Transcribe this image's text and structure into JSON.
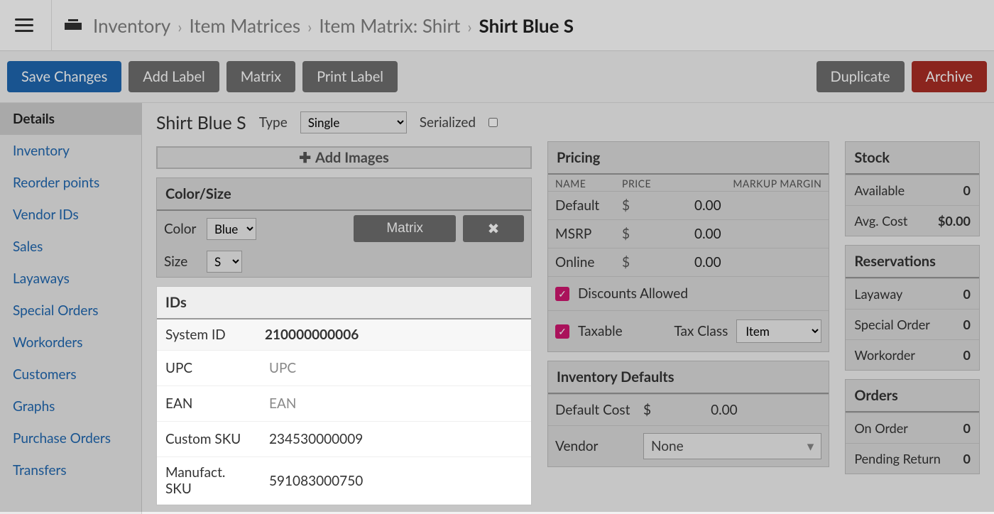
{
  "breadcrumb": {
    "root": "Inventory",
    "l1": "Item Matrices",
    "l2_prefix": "Item Matrix:",
    "l2_name": "Shirt",
    "current": "Shirt Blue S"
  },
  "actions": {
    "save": "Save Changes",
    "add_label": "Add Label",
    "matrix": "Matrix",
    "print_label": "Print Label",
    "duplicate": "Duplicate",
    "archive": "Archive"
  },
  "sidebar": {
    "items": [
      "Details",
      "Inventory",
      "Reorder points",
      "Vendor IDs",
      "Sales",
      "Layaways",
      "Special Orders",
      "Workorders",
      "Customers",
      "Graphs",
      "Purchase Orders",
      "Transfers"
    ],
    "active_index": 0
  },
  "title": {
    "name": "Shirt Blue S",
    "type_label": "Type",
    "type_value": "Single",
    "serialized_label": "Serialized"
  },
  "add_images": "Add Images",
  "color_size": {
    "header": "Color/Size",
    "color_label": "Color",
    "color_value": "Blue",
    "size_label": "Size",
    "size_value": "S",
    "matrix_btn": "Matrix"
  },
  "ids": {
    "header": "IDs",
    "system_id_label": "System ID",
    "system_id": "210000000006",
    "upc_label": "UPC",
    "ean_label": "EAN",
    "custom_sku_label": "Custom SKU",
    "custom_sku": "234530000009",
    "manu_sku_label": "Manufact. SKU",
    "manu_sku": "591083000750"
  },
  "pricing": {
    "header": "Pricing",
    "col_name": "NAME",
    "col_price": "PRICE",
    "col_markup": "MARKUP",
    "col_margin": "MARGIN",
    "rows": [
      {
        "name": "Default",
        "cur": "$",
        "val": "0.00"
      },
      {
        "name": "MSRP",
        "cur": "$",
        "val": "0.00"
      },
      {
        "name": "Online",
        "cur": "$",
        "val": "0.00"
      }
    ],
    "discounts_label": "Discounts Allowed",
    "taxable_label": "Taxable",
    "tax_class_label": "Tax Class",
    "tax_class_value": "Item"
  },
  "inv_defaults": {
    "header": "Inventory Defaults",
    "default_cost_label": "Default Cost",
    "default_cost_cur": "$",
    "default_cost_val": "0.00",
    "vendor_label": "Vendor",
    "vendor_value": "None"
  },
  "stock": {
    "header": "Stock",
    "available_label": "Available",
    "available": "0",
    "avg_cost_label": "Avg. Cost",
    "avg_cost": "$0.00"
  },
  "reservations": {
    "header": "Reservations",
    "rows": [
      {
        "label": "Layaway",
        "val": "0"
      },
      {
        "label": "Special Order",
        "val": "0"
      },
      {
        "label": "Workorder",
        "val": "0"
      }
    ]
  },
  "orders": {
    "header": "Orders",
    "rows": [
      {
        "label": "On Order",
        "val": "0"
      },
      {
        "label": "Pending Return",
        "val": "0"
      }
    ]
  }
}
